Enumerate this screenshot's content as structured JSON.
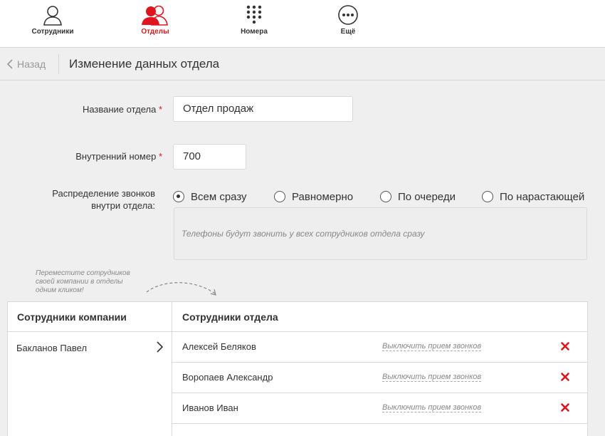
{
  "nav": {
    "items": [
      {
        "label": "Сотрудники",
        "icon": "person-icon",
        "active": false
      },
      {
        "label": "Отделы",
        "icon": "group-icon",
        "active": true
      },
      {
        "label": "Номера",
        "icon": "keypad-icon",
        "active": false
      },
      {
        "label": "Ещё",
        "icon": "more-icon",
        "active": false
      }
    ],
    "accent_color": "#e0141e"
  },
  "header": {
    "back_label": "Назад",
    "title": "Изменение данных отдела"
  },
  "form": {
    "name_label": "Название отдела",
    "name_value": "Отдел продаж",
    "ext_label": "Внутренний номер",
    "ext_value": "700",
    "required_mark": "*",
    "distribution_label_line1": "Распределение звонков",
    "distribution_label_line2": "внутри отдела:",
    "options": [
      "Всем сразу",
      "Равномерно",
      "По очереди",
      "По нарастающей"
    ],
    "selected_option": "Всем сразу",
    "hint": "Телефоны будут звонить у всех сотрудников отдела сразу"
  },
  "tip": {
    "line1": "Переместите сотрудников",
    "line2": "своей компании в отделы",
    "line3": "одним кликом!"
  },
  "company": {
    "header": "Сотрудники компании",
    "employees": [
      "Бакланов Павел"
    ]
  },
  "department": {
    "header": "Сотрудники отдела",
    "toggle_label": "Выключить прием звонков",
    "members": [
      "Алексей Беляков",
      "Воропаев Александр",
      "Иванов Иван"
    ]
  }
}
